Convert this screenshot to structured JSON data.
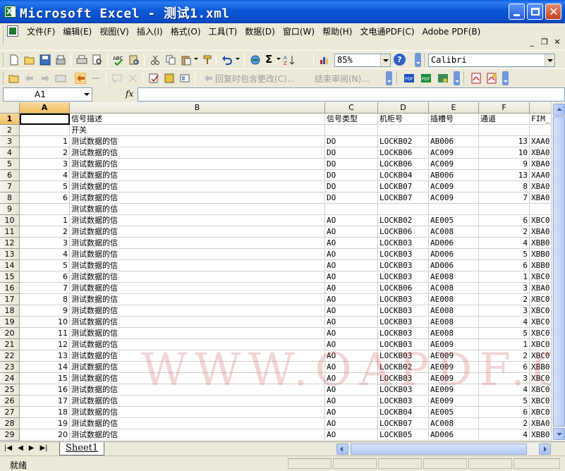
{
  "window": {
    "title": "Microsoft Excel - 测试1.xml"
  },
  "menu": {
    "items": [
      "文件(F)",
      "编辑(E)",
      "视图(V)",
      "插入(I)",
      "格式(O)",
      "工具(T)",
      "数据(D)",
      "窗口(W)",
      "帮助(H)",
      "文电通PDF(C)",
      "Adobe PDF(B)"
    ]
  },
  "toolbar": {
    "zoom": "85%",
    "font": "Calibri",
    "reply_changes": "回复时包含更改(C)...",
    "end_review": "结束审阅(N)..."
  },
  "formula_bar": {
    "name_box": "A1",
    "fx": "fx",
    "formula": ""
  },
  "sheet": {
    "columns": [
      {
        "id": "A",
        "width": 71
      },
      {
        "id": "B",
        "width": 362
      },
      {
        "id": "C",
        "width": 75
      },
      {
        "id": "D",
        "width": 72
      },
      {
        "id": "E",
        "width": 71
      },
      {
        "id": "F",
        "width": 72
      },
      {
        "id": "G",
        "width": 40
      }
    ],
    "column_labels": [
      "A",
      "B",
      "C",
      "D",
      "E",
      "F",
      ""
    ],
    "rows": [
      [
        "",
        "信号描述",
        "信号类型",
        "机柜号",
        "插槽号",
        "通道",
        "FIM_"
      ],
      [
        "",
        "开关",
        "",
        "",
        "",
        "",
        ""
      ],
      [
        "1",
        "测试数据的信",
        "DO",
        "LOCKB02",
        "AB006",
        "13",
        "XAA0"
      ],
      [
        "2",
        "测试数据的信",
        "DO",
        "LOCKB06",
        "AC009",
        "10",
        "XBA0"
      ],
      [
        "3",
        "测试数据的信",
        "DO",
        "LOCKB06",
        "AC009",
        "9",
        "XBA0"
      ],
      [
        "4",
        "测试数据的信",
        "DO",
        "LOCKB04",
        "AB006",
        "13",
        "XAA0"
      ],
      [
        "5",
        "测试数据的信",
        "DO",
        "LOCKB07",
        "AC009",
        "8",
        "XBA0"
      ],
      [
        "6",
        "测试数据的信",
        "DO",
        "LOCKB07",
        "AC009",
        "7",
        "XBA0"
      ],
      [
        "",
        "测试数据的信",
        "",
        "",
        "",
        "",
        ""
      ],
      [
        "1",
        "测试数据的信",
        "AO",
        "LOCKB02",
        "AE005",
        "6",
        "XBC0"
      ],
      [
        "2",
        "测试数据的信",
        "AO",
        "LOCKB06",
        "AC008",
        "2",
        "XBA0"
      ],
      [
        "3",
        "测试数据的信",
        "AO",
        "LOCKB03",
        "AD006",
        "4",
        "XBB0"
      ],
      [
        "4",
        "测试数据的信",
        "AO",
        "LOCKB03",
        "AD006",
        "5",
        "XBB0"
      ],
      [
        "5",
        "测试数据的信",
        "AO",
        "LOCKB03",
        "AD006",
        "6",
        "XBB0"
      ],
      [
        "6",
        "测试数据的信",
        "AO",
        "LOCKB03",
        "AE008",
        "1",
        "XBC0"
      ],
      [
        "7",
        "测试数据的信",
        "AO",
        "LOCKB06",
        "AC008",
        "3",
        "XBA0"
      ],
      [
        "8",
        "测试数据的信",
        "AO",
        "LOCKB03",
        "AE008",
        "2",
        "XBC0"
      ],
      [
        "9",
        "测试数据的信",
        "AO",
        "LOCKB03",
        "AE008",
        "3",
        "XBC0"
      ],
      [
        "10",
        "测试数据的信",
        "AO",
        "LOCKB03",
        "AE008",
        "4",
        "XBC0"
      ],
      [
        "11",
        "测试数据的信",
        "AO",
        "LOCKB03",
        "AE008",
        "5",
        "XBC0"
      ],
      [
        "12",
        "测试数据的信",
        "AO",
        "LOCKB03",
        "AE009",
        "1",
        "XBC0"
      ],
      [
        "13",
        "测试数据的信",
        "AO",
        "LOCKB03",
        "AE009",
        "2",
        "XBC0"
      ],
      [
        "14",
        "测试数据的信",
        "AO",
        "LOCKB02",
        "AE009",
        "6",
        "XBB0"
      ],
      [
        "15",
        "测试数据的信",
        "AO",
        "LOCKB03",
        "AE009",
        "3",
        "XBC0"
      ],
      [
        "16",
        "测试数据的信",
        "AO",
        "LOCKB03",
        "AE009",
        "4",
        "XBC0"
      ],
      [
        "17",
        "测试数据的信",
        "AO",
        "LOCKB03",
        "AE009",
        "5",
        "XBC0"
      ],
      [
        "18",
        "测试数据的信",
        "AO",
        "LOCKB04",
        "AE005",
        "6",
        "XBC0"
      ],
      [
        "19",
        "测试数据的信",
        "AO",
        "LOCKB07",
        "AC008",
        "2",
        "XBA0"
      ],
      [
        "20",
        "测试数据的信",
        "AO",
        "LOCKB05",
        "AD006",
        "4",
        "XBB0"
      ]
    ]
  },
  "sheet_tabs": {
    "active": "Sheet1"
  },
  "watermark": "WWW.OAPDF.COM",
  "status": {
    "text": "就绪"
  },
  "colors": {
    "title_bar": "#0a58d8",
    "chrome": "#ece9d8",
    "selected_header": "#f1c15f"
  },
  "icons": [
    "excel-app-icon",
    "minimize-icon",
    "maximize-icon",
    "close-icon",
    "new-icon",
    "open-icon",
    "save-icon",
    "print-icon",
    "sum-icon",
    "sort-icon",
    "chart-icon",
    "help-icon",
    "pdf-icon"
  ]
}
